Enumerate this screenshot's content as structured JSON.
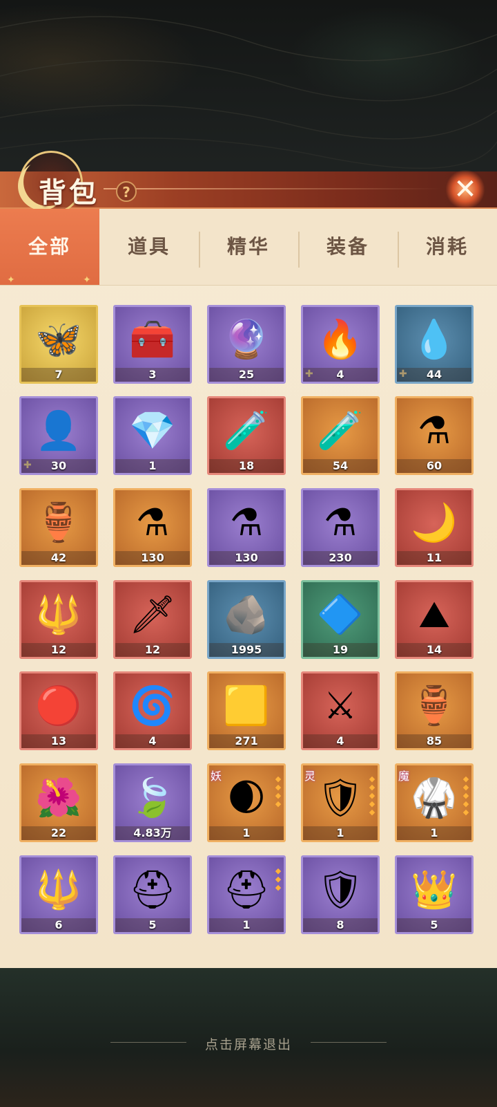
{
  "header": {
    "title": "背包",
    "help_label": "?",
    "close_label": "✕"
  },
  "tabs": [
    {
      "label": "全部",
      "active": true
    },
    {
      "label": "道具",
      "active": false
    },
    {
      "label": "精华",
      "active": false
    },
    {
      "label": "装备",
      "active": false
    },
    {
      "label": "消耗",
      "active": false
    }
  ],
  "items": [
    {
      "name": "butterfly-wings",
      "count": "7",
      "rarity": "gold",
      "icon": "🦋"
    },
    {
      "name": "treasure-chest-open",
      "count": "3",
      "rarity": "purple",
      "icon": "🧰"
    },
    {
      "name": "golden-chest-orb",
      "count": "25",
      "rarity": "purple",
      "icon": "🔮"
    },
    {
      "name": "purple-spirit-flame",
      "count": "4",
      "rarity": "purple",
      "icon": "🔥",
      "puzzle": true
    },
    {
      "name": "blue-spirit-flame",
      "count": "44",
      "rarity": "blue",
      "icon": "💧",
      "puzzle": true
    },
    {
      "name": "character-portrait",
      "count": "30",
      "rarity": "purple",
      "icon": "👤",
      "puzzle": true
    },
    {
      "name": "crystal-spirit",
      "count": "1",
      "rarity": "purple",
      "icon": "💎"
    },
    {
      "name": "green-elixir-flask",
      "count": "18",
      "rarity": "red",
      "icon": "🧪"
    },
    {
      "name": "purple-elixir-flask",
      "count": "54",
      "rarity": "orange",
      "icon": "🧪"
    },
    {
      "name": "red-potion",
      "count": "60",
      "rarity": "orange",
      "icon": "⚗"
    },
    {
      "name": "golden-elixir-flask",
      "count": "42",
      "rarity": "orange",
      "icon": "🏺"
    },
    {
      "name": "green-potion",
      "count": "130",
      "rarity": "orange",
      "icon": "⚗"
    },
    {
      "name": "violet-potion",
      "count": "130",
      "rarity": "purple",
      "icon": "⚗"
    },
    {
      "name": "amber-potion",
      "count": "230",
      "rarity": "purple",
      "icon": "⚗"
    },
    {
      "name": "crescent-staff",
      "count": "11",
      "rarity": "red",
      "icon": "🌙"
    },
    {
      "name": "golden-spear",
      "count": "12",
      "rarity": "red",
      "icon": "🔱"
    },
    {
      "name": "silver-spear",
      "count": "12",
      "rarity": "red",
      "icon": "🗡"
    },
    {
      "name": "spirit-stone",
      "count": "1995",
      "rarity": "blue",
      "icon": "🪨"
    },
    {
      "name": "dark-gem",
      "count": "19",
      "rarity": "green",
      "icon": "🔷"
    },
    {
      "name": "pink-salt-pile",
      "count": "14",
      "rarity": "red",
      "icon": "⛰"
    },
    {
      "name": "fire-orb",
      "count": "13",
      "rarity": "red",
      "icon": "🔴"
    },
    {
      "name": "phoenix-swirl",
      "count": "4",
      "rarity": "red",
      "icon": "🌀"
    },
    {
      "name": "gold-ore",
      "count": "271",
      "rarity": "orange",
      "icon": "🟨"
    },
    {
      "name": "sword-banner",
      "count": "4",
      "rarity": "red",
      "icon": "⚔"
    },
    {
      "name": "golden-gourd",
      "count": "85",
      "rarity": "orange",
      "icon": "🏺"
    },
    {
      "name": "red-flower",
      "count": "22",
      "rarity": "orange",
      "icon": "🌺"
    },
    {
      "name": "crystal-leaf",
      "count": "4.83万",
      "rarity": "purple",
      "icon": "🍃"
    },
    {
      "name": "crescent-blade",
      "count": "1",
      "rarity": "orange",
      "icon": "🌒",
      "tag": "妖",
      "stars": 4
    },
    {
      "name": "blue-armor-belt",
      "count": "1",
      "rarity": "orange",
      "icon": "🛡",
      "tag": "灵",
      "stars": 5
    },
    {
      "name": "blue-robe",
      "count": "1",
      "rarity": "orange",
      "icon": "🥋",
      "tag": "魔",
      "stars": 5
    },
    {
      "name": "jeweled-spear",
      "count": "6",
      "rarity": "purple",
      "icon": "🔱"
    },
    {
      "name": "red-crest-helmet",
      "count": "5",
      "rarity": "purple",
      "icon": "⛑"
    },
    {
      "name": "red-crest-helmet-star",
      "count": "1",
      "rarity": "purple",
      "icon": "⛑",
      "stars": 3
    },
    {
      "name": "golden-chestplate",
      "count": "8",
      "rarity": "purple",
      "icon": "🛡"
    },
    {
      "name": "golden-crown",
      "count": "5",
      "rarity": "purple",
      "icon": "👑"
    }
  ],
  "footer": {
    "exit_hint": "点击屏幕退出"
  }
}
